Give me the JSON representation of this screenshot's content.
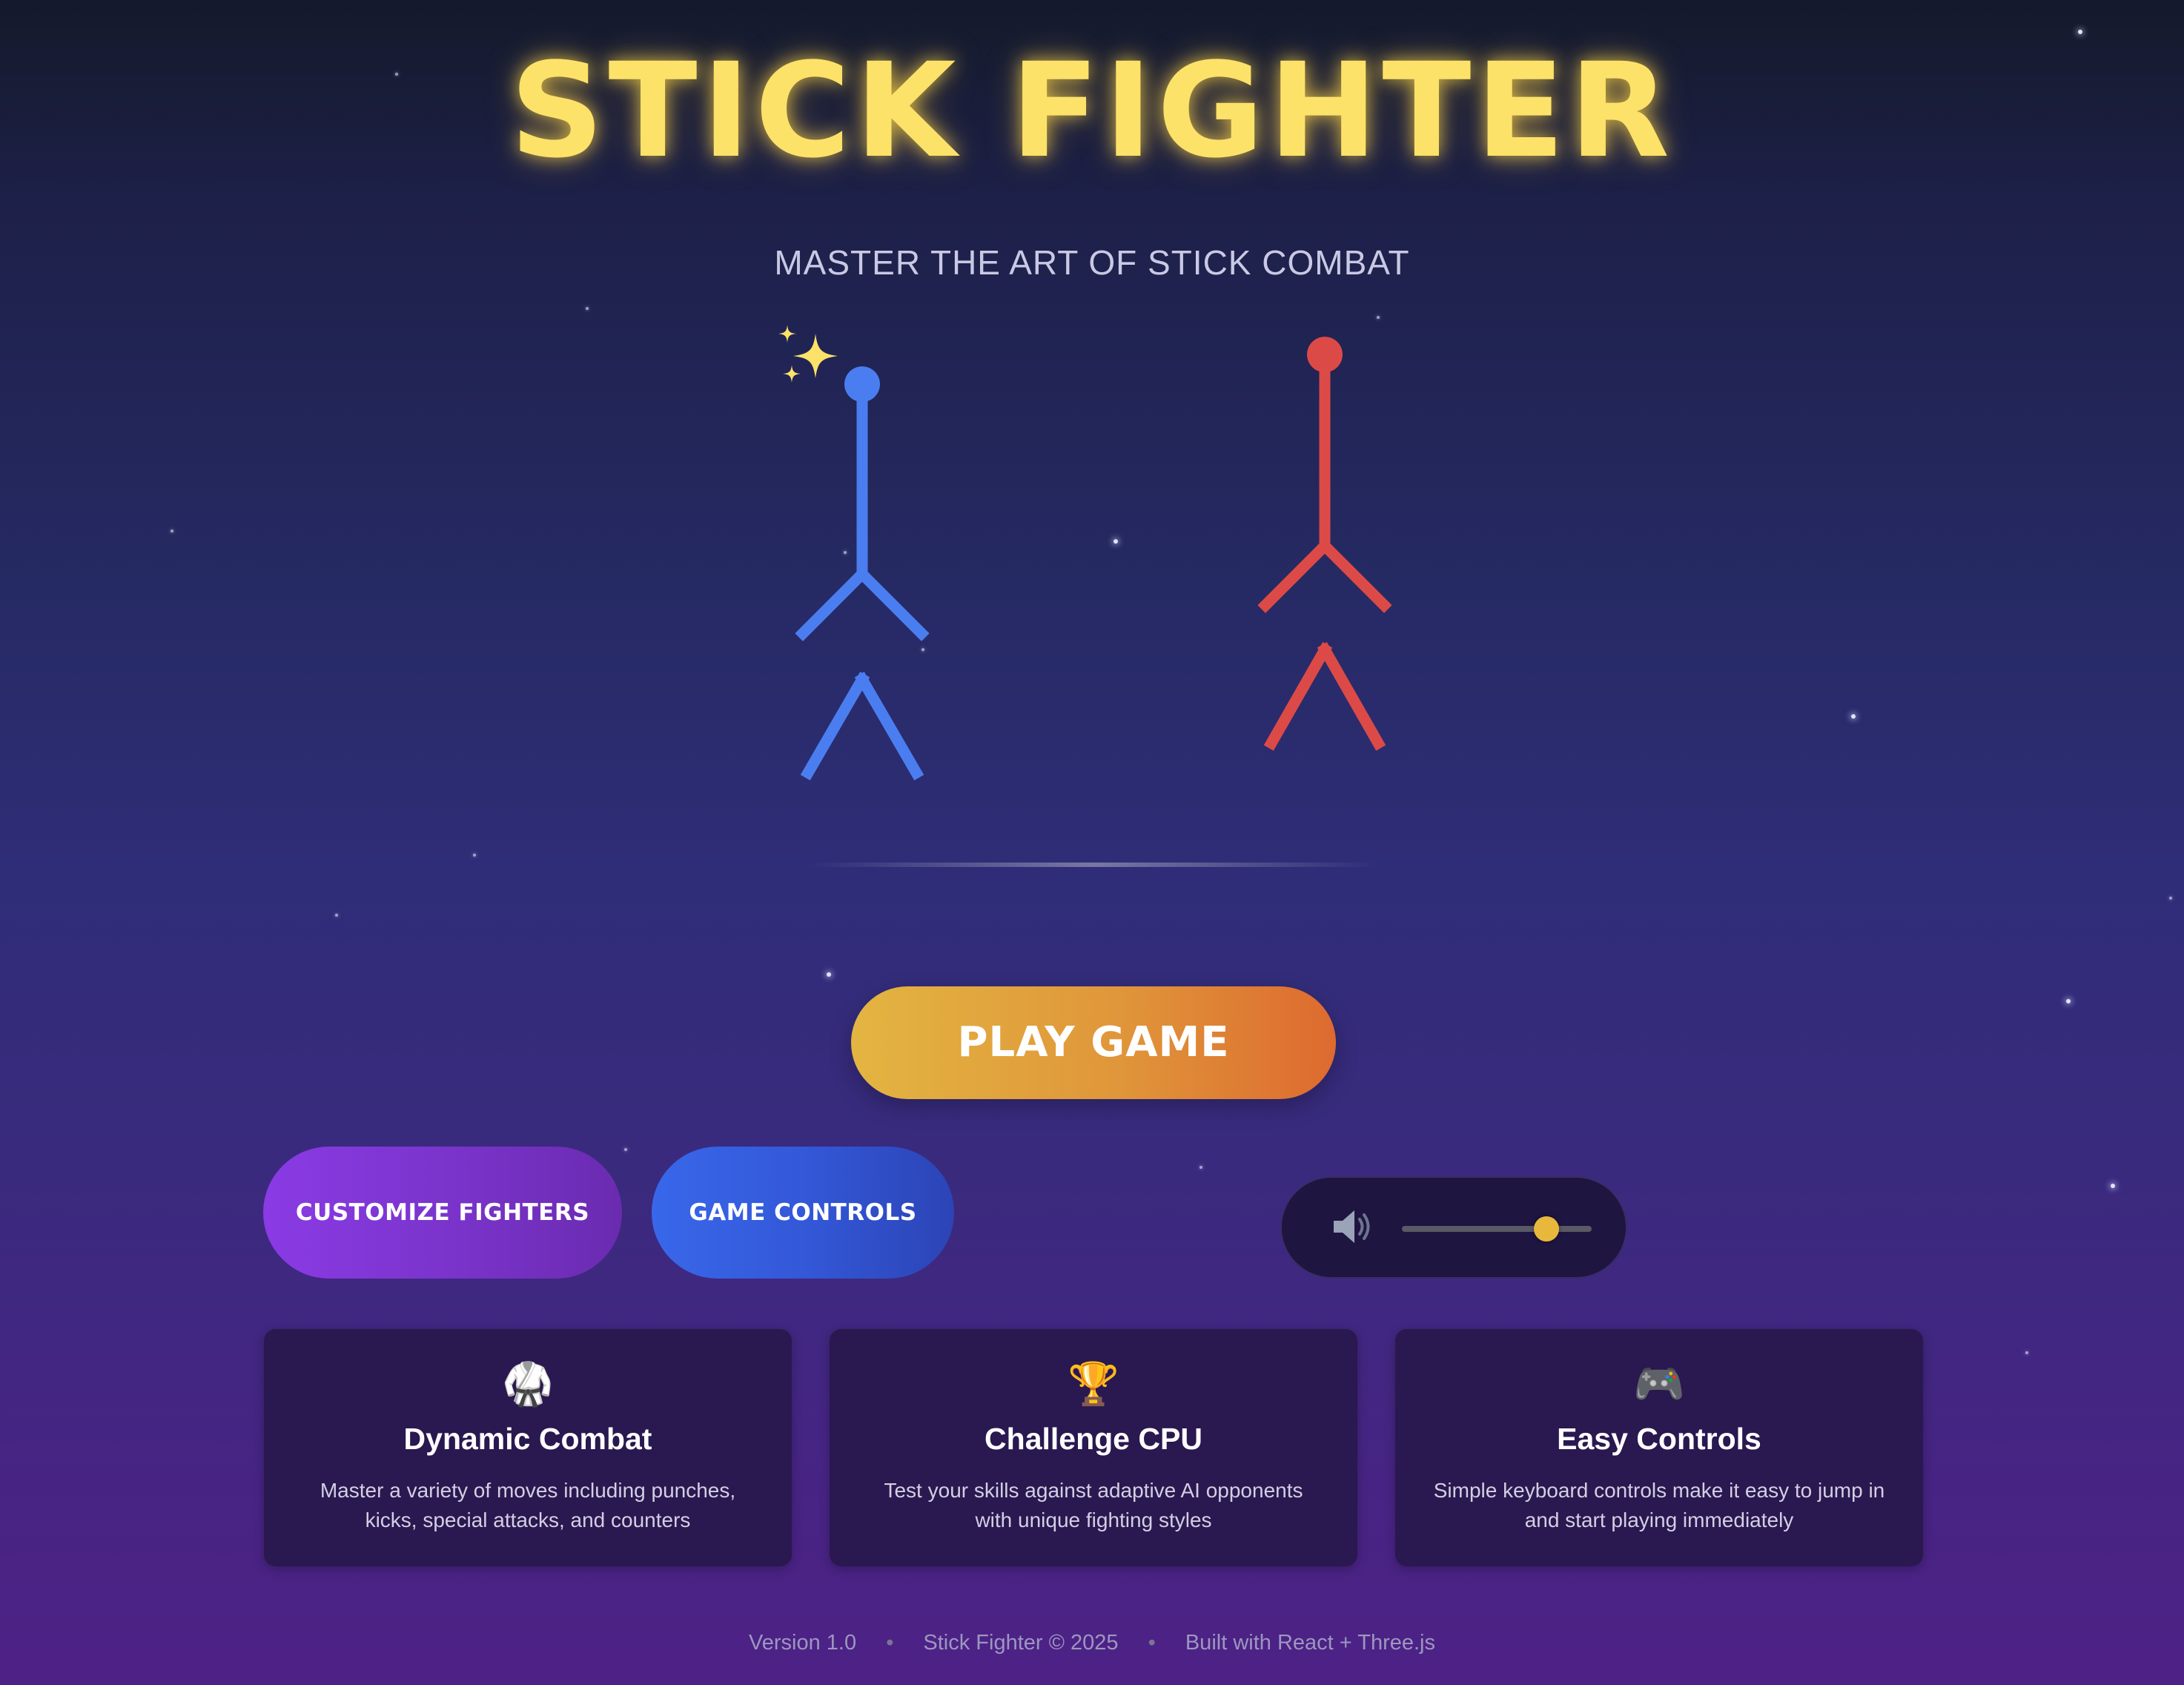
{
  "app": {
    "title": "STICK FIGHTER",
    "subtitle": "MASTER THE ART OF STICK COMBAT"
  },
  "fighters": {
    "blue": {
      "name": "blue-fighter",
      "color": "#4a7ef0"
    },
    "red": {
      "name": "red-fighter",
      "color": "#dc4a47"
    },
    "sparkle_icon": "sparkles-icon",
    "sparkle_color": "#fde26a"
  },
  "buttons": {
    "play": "PLAY GAME",
    "customize": "CUSTOMIZE FIGHTERS",
    "controls": "GAME CONTROLS"
  },
  "volume": {
    "icon": "speaker-icon",
    "level": 0.76
  },
  "features": [
    {
      "icon": "martial-arts-uniform-icon",
      "emoji": "🥋",
      "title": "Dynamic Combat",
      "description": "Master a variety of moves including punches, kicks, special attacks, and counters"
    },
    {
      "icon": "trophy-icon",
      "emoji": "🏆",
      "title": "Challenge CPU",
      "description": "Test your skills against adaptive AI opponents with unique fighting styles"
    },
    {
      "icon": "game-controller-icon",
      "emoji": "🎮",
      "title": "Easy Controls",
      "description": "Simple keyboard controls make it easy to jump in and start playing immediately"
    }
  ],
  "footer": {
    "version": "Version 1.0",
    "copyright": "Stick Fighter © 2025",
    "built_with": "Built with React + Three.js",
    "separator": "•"
  },
  "colors": {
    "title": "#fde26a",
    "play_start": "#e3b541",
    "play_end": "#dd6a2f",
    "customize": "#8a3be5",
    "controls": "#3967ea",
    "card_bg": "#2a1850",
    "slider_thumb": "#e7b83c"
  }
}
